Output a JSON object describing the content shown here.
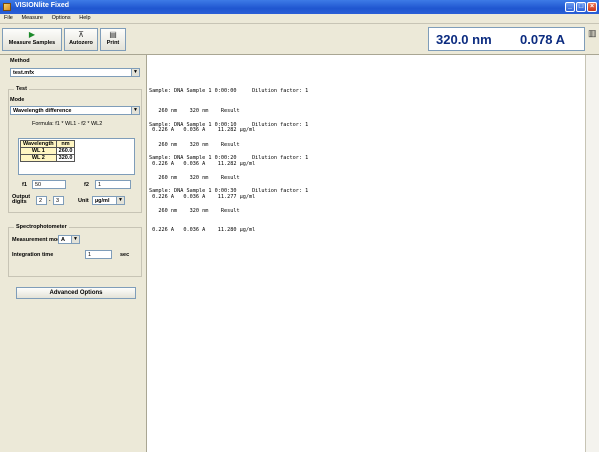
{
  "window": {
    "title": "VISIONlite Fixed",
    "min": "_",
    "max": "□",
    "close": "×"
  },
  "menu": [
    {
      "label": "File"
    },
    {
      "label": "Measure"
    },
    {
      "label": "Options"
    },
    {
      "label": "Help"
    }
  ],
  "toolbar": {
    "measure_label": "Measure Samples",
    "autozero_label": "Autozero",
    "print_label": "Print"
  },
  "readout": {
    "wavelength": "320.0 nm",
    "absorbance": "0.078 A"
  },
  "panel": {
    "method_label": "Method",
    "method_value": "test.mfx",
    "test_label": "Test",
    "mode_label": "Mode",
    "mode_value": "Wavelength difference",
    "formula": "Formula: f1 * WL1 - f2 * WL2",
    "table": {
      "headers": [
        "Wavelength",
        "nm"
      ],
      "rows": [
        {
          "name": "WL 1",
          "value": "260.0"
        },
        {
          "name": "WL 2",
          "value": "320.0"
        }
      ]
    },
    "f1_label": "f1",
    "f1_value": "50",
    "f2_label": "f2",
    "f2_value": "1",
    "output_label": "Output digits",
    "digits_int": "2",
    "digits_sep": ".",
    "digits_dec": "3",
    "unit_label": "Unit",
    "unit_value": "µg/ml",
    "spectro_label": "Spectrophotometer",
    "measmode_label": "Measurement mode",
    "measmode_value": "A",
    "integ_label": "Integration time",
    "integ_value": "1",
    "integ_unit": "sec",
    "advanced_label": "Advanced Options"
  },
  "log": [
    {
      "head": "Sample: DNA Sample 1 0:00:00     Dilution factor: 1",
      "cols": "   260 nm    320 nm    Result",
      "vals": " 0.226 A   0.036 A    11.282 µg/ml"
    },
    {
      "head": "Sample: DNA Sample 1 0:00:10     Dilution factor: 1",
      "cols": "   260 nm    320 nm    Result",
      "vals": " 0.226 A   0.036 A    11.282 µg/ml"
    },
    {
      "head": "Sample: DNA Sample 1 0:00:20     Dilution factor: 1",
      "cols": "   260 nm    320 nm    Result",
      "vals": " 0.226 A   0.036 A    11.277 µg/ml"
    },
    {
      "head": "Sample: DNA Sample 1 0:00:30     Dilution factor: 1",
      "cols": "   260 nm    320 nm    Result",
      "vals": " 0.226 A   0.036 A    11.280 µg/ml"
    }
  ]
}
